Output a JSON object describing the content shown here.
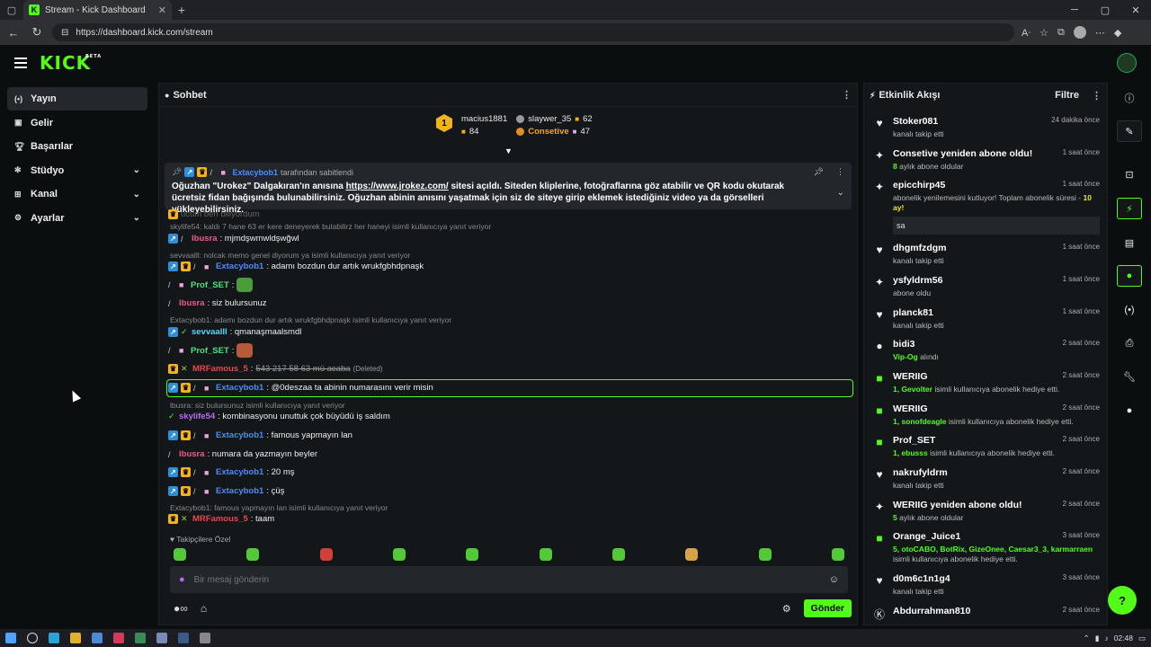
{
  "browser": {
    "tab_title": "Stream - Kick Dashboard",
    "url": "https://dashboard.kick.com/stream"
  },
  "header": {
    "logo": "KICK",
    "logo_badge": "BETA"
  },
  "sidebar": {
    "items": [
      {
        "label": "Yayın",
        "icon": "broadcast-icon"
      },
      {
        "label": "Gelir",
        "icon": "money-icon"
      },
      {
        "label": "Başarılar",
        "icon": "trophy-icon"
      },
      {
        "label": "Stüdyo",
        "icon": "studio-icon"
      },
      {
        "label": "Kanal",
        "icon": "channel-icon"
      },
      {
        "label": "Ayarlar",
        "icon": "settings-icon"
      }
    ]
  },
  "chat": {
    "title": "Sohbet",
    "leaders": {
      "first": {
        "rank": "1",
        "name": "macius1881",
        "count": "84"
      },
      "second": {
        "name": "slaywer_35",
        "count": "62"
      },
      "third": {
        "name": "Consetive",
        "count": "47"
      }
    },
    "pinned": {
      "author": "Extacybob1",
      "label": "tarafından sabitlendi",
      "text_before": "Oğuzhan \"Urokez\" Dalgakıran'ın anısına",
      "link": "https://www.jrokez.com/",
      "text_after": "sitesi açıldı. Siteden kliplerine, fotoğraflarına göz atabilir ve QR kodu okutarak ücretsiz fidan bağışında bulunabilirsiniz. Oğuzhan abinin anısını yaşatmak için siz de siteye girip eklemek istediğiniz video ya da görselleri yükleyebilirsiniz."
    },
    "messages": {
      "partial_text": "ucum ben biliyordum",
      "r1": "skylife54: kaldı 7 hane 63 er kere deneyerek bulabilirz her haneyi isimli kullanıcıya yanıt veriyor",
      "m1_user": "lbusra",
      "m1_text": ": mjmdşwmwldşwğwl",
      "r2": "sevvaalll: nolcak memo genel diyorum ya isimli kullanıcıya yanıt veriyor",
      "m2_user": "Extacybob1",
      "m2_text": ": adamı bozdun dur artık wrukfgbhdpnaşk",
      "m3_user": "Prof_SET",
      "m3_text": ":",
      "m4_user": "lbusra",
      "m4_text": ": siz bulursunuz",
      "r3": "Extacybob1: adamı bozdun dur artık wrukfgbhdpnaşk isimli kullanıcıya yanıt veriyor",
      "m5_user": "sevvaalll",
      "m5_text": ": qmanaşmaalsmdl",
      "m6_user": "Prof_SET",
      "m6_text": ":",
      "m7_user": "MRFamous_5",
      "m7_text": "543 217 58 63 mü acaba",
      "m7_deleted": "(Deleted)",
      "m8_user": "Extacybob1",
      "m8_text": ": @0deszaa ta abinin numarasını verir misin",
      "r4": "lbusra: siz bulursunuz isimli kullanıcıya yanıt veriyor",
      "m9_user": "skylife54",
      "m9_text": ": kombinasyonu unuttuk çok büyüdü iş saldım",
      "m10_user": "Extacybob1",
      "m10_text": ": famous yapmayın lan",
      "m11_user": "lbusra",
      "m11_text": ": numara da yazmayın beyler",
      "m12_user": "Extacybob1",
      "m12_text": ": 20 mş",
      "m13_user": "Extacybob1",
      "m13_text": ": çüş",
      "r5": "Extacybob1: famous yapmayın lan isimli kullanıcıya yanıt veriyor",
      "m14_user": "MRFamous_5",
      "m14_text": ": taam"
    },
    "follower_label": "Takipçilere Özel",
    "input_placeholder": "Bir mesaj gönderin",
    "send_label": "Gönder",
    "infinity": "∞"
  },
  "activity": {
    "title": "Etkinlik Akışı",
    "filter_label": "Filtre",
    "events": [
      {
        "name": "Stoker081",
        "time": "24 dakika önce",
        "sub": "kanalı takip etti"
      },
      {
        "name": "Consetive yeniden abone oldu!",
        "time": "1 saat önce",
        "sub_g": "8",
        "sub": "aylık abone oldular"
      },
      {
        "name": "epicchirp45",
        "time": "1 saat önce",
        "sub": "abonelik yenilemesini kutluyor! Toplam abonelik süresi -",
        "sub_y": "10 ay!",
        "msg": "sa"
      },
      {
        "name": "dhgmfzdgm",
        "time": "1 saat önce",
        "sub": "kanalı takip etti"
      },
      {
        "name": "ysfyldrm56",
        "time": "1 saat önce",
        "sub": "abone oldu"
      },
      {
        "name": "planck81",
        "time": "1 saat önce",
        "sub": "kanalı takip etti"
      },
      {
        "name": "bidi3",
        "time": "2 saat önce",
        "sub_g": "Vip-Og",
        "sub": "alındı"
      },
      {
        "name": "WERIIG",
        "time": "2 saat önce",
        "sub_g": "1, Gevolter",
        "sub": "isimli kullanıcıya abonelik hediye etti."
      },
      {
        "name": "WERIIG",
        "time": "2 saat önce",
        "sub_g": "1, sonofdeagle",
        "sub": "isimli kullanıcıya abonelik hediye etti."
      },
      {
        "name": "Prof_SET",
        "time": "2 saat önce",
        "sub_g": "1, ebusss",
        "sub": "isimli kullanıcıya abonelik hediye etti."
      },
      {
        "name": "nakrufyldrm",
        "time": "2 saat önce",
        "sub": "kanalı takip etti"
      },
      {
        "name": "WERIIG yeniden abone oldu!",
        "time": "2 saat önce",
        "sub_g": "5",
        "sub": "aylık abone oldular"
      },
      {
        "name": "Orange_Juice1",
        "time": "3 saat önce",
        "sub_g": "5, otoCABO, BotRix, GizeOnee, Caesar3_3, karmarraen",
        "sub": "isimli kullanıcıya abonelik hediye etti."
      },
      {
        "name": "d0m6c1n1g4",
        "time": "3 saat önce",
        "sub": "kanalı takip etti"
      },
      {
        "name": "Abdurrahman810",
        "time": "2 saat önce",
        "sub": ""
      }
    ]
  },
  "taskbar": {
    "time": "02:48"
  },
  "colors": {
    "accent": "#53fc18",
    "panel": "#14171a",
    "background": "#0b0e0f"
  }
}
